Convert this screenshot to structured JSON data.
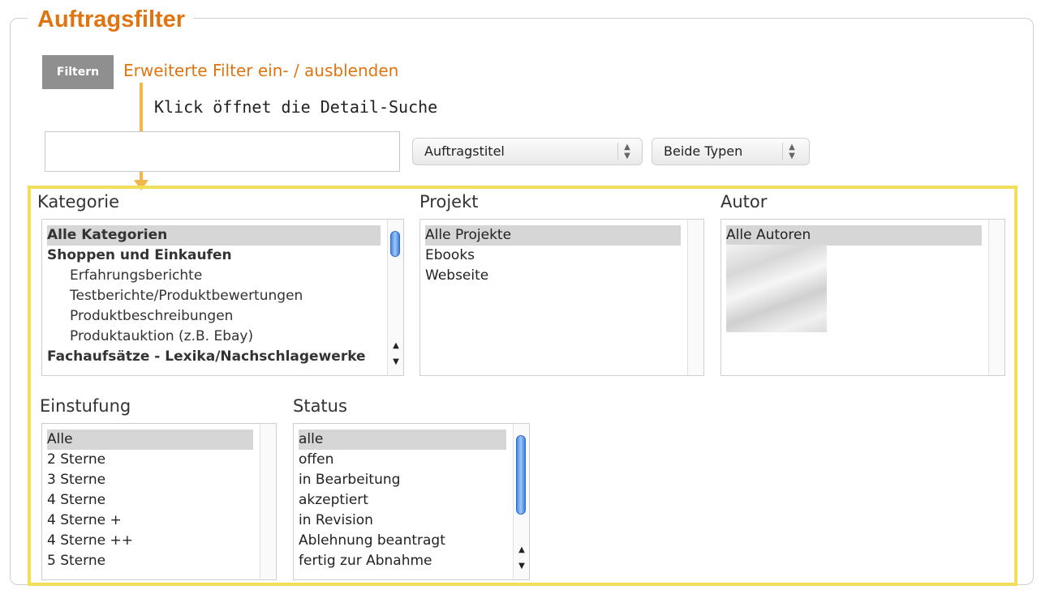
{
  "legend": "Auftragsfilter",
  "filter_button": "Filtern",
  "toggle_link": "Erweiterte Filter ein- / ausblenden",
  "annotation": "Klick öffnet die Detail-Suche",
  "search": {
    "value": "",
    "placeholder": ""
  },
  "field_select": {
    "selected": "Auftragstitel"
  },
  "type_select": {
    "selected": "Beide Typen"
  },
  "colors": {
    "accent_orange": "#e07410",
    "highlight_yellow": "#f2de5a",
    "arrow_orange": "#f3b64a",
    "button_gray": "#8f8f8f",
    "scroll_thumb_blue": "#4a8ae5"
  },
  "icons": {
    "select_arrows": "up-down-arrows-icon",
    "scroll_up": "scroll-up-arrow-icon",
    "scroll_down": "scroll-down-arrow-icon"
  },
  "kategorie": {
    "label": "Kategorie",
    "items": [
      "Alle Kategorien",
      "Shoppen und Einkaufen",
      "Erfahrungsberichte",
      "Testberichte/Produktbewertungen",
      "Produktbeschreibungen",
      "Produktauktion (z.B. Ebay)",
      "Fachaufsätze - Lexika/Nachschlagewerke"
    ],
    "selected_index": 0
  },
  "projekt": {
    "label": "Projekt",
    "items": [
      "Alle Projekte",
      "Ebooks",
      "Webseite"
    ],
    "selected_index": 0
  },
  "autor": {
    "label": "Autor",
    "items": [
      "Alle Autoren"
    ],
    "selected_index": 0
  },
  "einstufung": {
    "label": "Einstufung",
    "items": [
      "Alle",
      "2 Sterne",
      "3 Sterne",
      "4 Sterne",
      "4 Sterne +",
      "4 Sterne ++",
      "5 Sterne"
    ],
    "selected_index": 0
  },
  "status": {
    "label": "Status",
    "items": [
      "alle",
      "offen",
      "in Bearbeitung",
      "akzeptiert",
      "in Revision",
      "Ablehnung beantragt",
      "fertig zur Abnahme"
    ],
    "selected_index": 0
  }
}
